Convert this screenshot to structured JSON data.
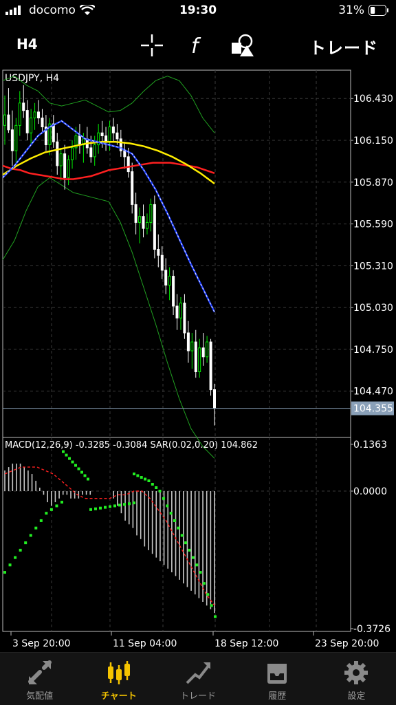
{
  "status_bar": {
    "carrier": "docomo",
    "time": "19:30",
    "battery": "31%",
    "battery_level": 0.31
  },
  "toolbar": {
    "timeframe": "H4",
    "trade_label": "トレード"
  },
  "chart_data": {
    "type": "candlestick",
    "symbol_label": "USDJPY, H4",
    "price_axis": {
      "ticks": [
        "106.430",
        "106.150",
        "105.870",
        "105.590",
        "105.310",
        "105.030",
        "104.750",
        "104.470"
      ],
      "range": [
        104.16,
        106.62
      ]
    },
    "current_price": "104.355",
    "x_ticks": [
      "3 Sep 20:00",
      "11 Sep 04:00",
      "18 Sep 12:00",
      "23 Sep 20:00"
    ],
    "candles": [
      [
        106.25,
        106.45,
        106.12,
        106.32
      ],
      [
        106.32,
        106.5,
        106.2,
        106.22
      ],
      [
        106.22,
        106.35,
        105.98,
        106.08
      ],
      [
        106.08,
        106.3,
        106.0,
        106.25
      ],
      [
        106.25,
        106.48,
        106.18,
        106.4
      ],
      [
        106.4,
        106.52,
        106.3,
        106.35
      ],
      [
        106.35,
        106.42,
        106.15,
        106.2
      ],
      [
        106.2,
        106.36,
        106.12,
        106.3
      ],
      [
        106.3,
        106.4,
        106.22,
        106.34
      ],
      [
        106.34,
        106.42,
        106.26,
        106.3
      ],
      [
        106.3,
        106.36,
        106.2,
        106.24
      ],
      [
        106.24,
        106.32,
        106.08,
        106.12
      ],
      [
        106.12,
        106.3,
        106.05,
        106.26
      ],
      [
        106.26,
        106.32,
        106.1,
        106.14
      ],
      [
        106.14,
        106.2,
        105.92,
        105.98
      ],
      [
        105.98,
        106.1,
        105.88,
        106.06
      ],
      [
        106.06,
        106.12,
        105.82,
        105.9
      ],
      [
        105.9,
        106.05,
        105.85,
        106.02
      ],
      [
        106.02,
        106.15,
        105.96,
        106.1
      ],
      [
        106.1,
        106.24,
        106.02,
        106.18
      ],
      [
        106.18,
        106.26,
        106.06,
        106.12
      ],
      [
        106.12,
        106.2,
        106.0,
        106.16
      ],
      [
        106.16,
        106.24,
        106.06,
        106.1
      ],
      [
        106.1,
        106.18,
        106.0,
        106.04
      ],
      [
        106.04,
        106.18,
        105.98,
        106.12
      ],
      [
        106.12,
        106.26,
        106.06,
        106.2
      ],
      [
        106.2,
        106.28,
        106.1,
        106.18
      ],
      [
        106.18,
        106.24,
        106.08,
        106.14
      ],
      [
        106.14,
        106.28,
        106.08,
        106.24
      ],
      [
        106.24,
        106.3,
        106.14,
        106.2
      ],
      [
        106.2,
        106.26,
        106.12,
        106.16
      ],
      [
        106.16,
        106.22,
        106.04,
        106.08
      ],
      [
        106.08,
        106.14,
        105.96,
        106.04
      ],
      [
        106.04,
        106.1,
        105.9,
        105.94
      ],
      [
        105.94,
        106.0,
        105.66,
        105.72
      ],
      [
        105.72,
        105.8,
        105.52,
        105.6
      ],
      [
        105.6,
        105.7,
        105.46,
        105.64
      ],
      [
        105.64,
        105.72,
        105.5,
        105.56
      ],
      [
        105.56,
        105.66,
        105.52,
        105.6
      ],
      [
        105.6,
        105.76,
        105.54,
        105.72
      ],
      [
        105.72,
        105.78,
        105.36,
        105.42
      ],
      [
        105.42,
        105.52,
        105.3,
        105.38
      ],
      [
        105.38,
        105.44,
        105.22,
        105.28
      ],
      [
        105.28,
        105.36,
        105.12,
        105.18
      ],
      [
        105.18,
        105.3,
        105.08,
        105.24
      ],
      [
        105.24,
        105.28,
        104.98,
        105.04
      ],
      [
        105.04,
        105.12,
        104.88,
        104.96
      ],
      [
        104.96,
        105.1,
        104.88,
        105.06
      ],
      [
        105.06,
        105.12,
        104.82,
        104.86
      ],
      [
        104.86,
        104.94,
        104.66,
        104.74
      ],
      [
        104.74,
        104.86,
        104.62,
        104.8
      ],
      [
        104.8,
        104.88,
        104.56,
        104.6
      ],
      [
        104.6,
        104.82,
        104.56,
        104.76
      ],
      [
        104.76,
        104.86,
        104.64,
        104.7
      ],
      [
        104.7,
        104.84,
        104.66,
        104.8
      ],
      [
        104.8,
        104.82,
        104.44,
        104.48
      ],
      [
        104.48,
        104.52,
        104.24,
        104.355
      ]
    ],
    "ma_red": [
      105.98,
      105.96,
      105.95,
      105.93,
      105.92,
      105.91,
      105.9,
      105.89,
      105.89,
      105.9,
      105.91,
      105.93,
      105.95,
      105.96,
      105.97,
      105.98,
      105.99,
      106.0,
      106.0,
      106.0,
      105.99,
      105.98,
      105.97,
      105.95,
      105.93
    ],
    "ma_yellow": [
      105.92,
      105.98,
      106.03,
      106.07,
      106.09,
      106.11,
      106.13,
      106.14,
      106.14,
      106.13,
      106.11,
      106.08,
      106.04,
      105.99,
      105.93,
      105.86
    ],
    "ma_blue": [
      105.9,
      105.98,
      106.08,
      106.18,
      106.24,
      106.28,
      106.22,
      106.16,
      106.14,
      106.12,
      106.1,
      106.06,
      105.95,
      105.82,
      105.66,
      105.49,
      105.32,
      105.16,
      105.0
    ],
    "bb_upper": [
      106.55,
      106.58,
      106.52,
      106.48,
      106.4,
      106.38,
      106.4,
      106.42,
      106.38,
      106.34,
      106.35,
      106.4,
      106.48,
      106.55,
      106.58,
      106.55,
      106.45,
      106.3,
      106.2
    ],
    "bb_lower": [
      105.35,
      105.48,
      105.68,
      105.84,
      105.9,
      105.85,
      105.8,
      105.78,
      105.76,
      105.74,
      105.6,
      105.4,
      105.16,
      104.92,
      104.66,
      104.42,
      104.22,
      104.1,
      104.02
    ],
    "macd": {
      "label": "MACD(12,26,9) -0.3285 -0.3084 SAR(0.02,0.20) 104.862",
      "ticks": [
        "0.1363",
        "0.0000",
        "-0.3726"
      ],
      "range": [
        -0.3726,
        0.1363
      ],
      "histogram": [
        0.06,
        0.07,
        0.08,
        0.08,
        0.08,
        0.07,
        0.06,
        0.05,
        0.03,
        0.01,
        -0.01,
        -0.03,
        -0.04,
        -0.03,
        -0.02,
        -0.01,
        -0.01,
        -0.02,
        -0.02,
        -0.02,
        -0.01,
        -0.01,
        -0.01,
        0.0,
        0.0,
        0.0,
        0.0,
        0.0,
        -0.02,
        -0.04,
        -0.06,
        -0.08,
        -0.09,
        -0.1,
        -0.12,
        -0.13,
        -0.15,
        -0.16,
        -0.17,
        -0.18,
        -0.19,
        -0.2,
        -0.21,
        -0.22,
        -0.23,
        -0.24,
        -0.25,
        -0.26,
        -0.27,
        -0.28,
        -0.29,
        -0.3,
        -0.31,
        -0.32,
        -0.33
      ],
      "signal": [
        0.05,
        0.06,
        0.07,
        0.07,
        0.07,
        0.06,
        0.05,
        0.03,
        0.01,
        -0.01,
        -0.02,
        -0.02,
        -0.02,
        -0.02,
        -0.01,
        -0.01,
        -0.0,
        0.0,
        -0.02,
        -0.05,
        -0.08,
        -0.12,
        -0.16,
        -0.2,
        -0.24,
        -0.28,
        -0.31
      ],
      "sar_upper": [
        0.115,
        0.105,
        0.095,
        0.085,
        0.075,
        0.065,
        0.055,
        0.045,
        0.035
      ],
      "sar_lower": [
        -0.22,
        -0.2,
        -0.18,
        -0.16,
        -0.14,
        -0.12,
        -0.1,
        -0.08,
        -0.06,
        -0.05,
        -0.04,
        -0.03
      ],
      "sar_mid": [
        -0.05,
        -0.048,
        -0.046,
        -0.044,
        -0.042,
        -0.04,
        -0.038,
        -0.036,
        -0.034,
        -0.032
      ],
      "sar_right": [
        0.05,
        0.045,
        0.04,
        0.035,
        0.03,
        0.02,
        0.01,
        0.0,
        -0.02,
        -0.04,
        -0.06,
        -0.08,
        -0.1,
        -0.12,
        -0.14,
        -0.16,
        -0.18,
        -0.2,
        -0.22,
        -0.25,
        -0.28,
        -0.31,
        -0.34
      ]
    },
    "colors": {
      "bull": "#00ee00",
      "bear": "#ffffff",
      "ma_red": "#ff2020",
      "ma_yellow": "#ffee00",
      "ma_blue": "#2040ff",
      "bb": "#20a020",
      "grid": "#3a3a3a",
      "macd_hist": "#c8c8c8",
      "macd_signal": "#ff2020",
      "sar": "#22ee22"
    }
  },
  "tabs": [
    {
      "label": "気配値",
      "icon": "quotes-icon",
      "active": false
    },
    {
      "label": "チャート",
      "icon": "chart-icon",
      "active": true
    },
    {
      "label": "トレード",
      "icon": "trade-icon",
      "active": false
    },
    {
      "label": "履歴",
      "icon": "history-icon",
      "active": false
    },
    {
      "label": "設定",
      "icon": "settings-icon",
      "active": false
    }
  ]
}
